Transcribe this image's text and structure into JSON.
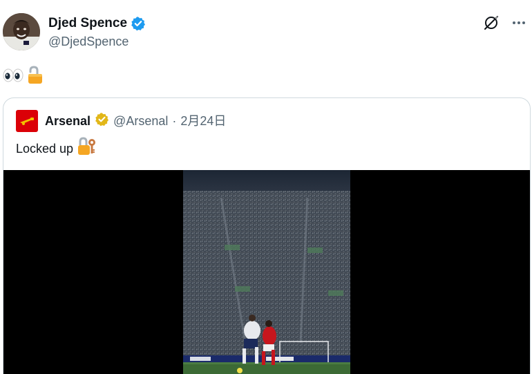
{
  "author": {
    "name": "Djed Spence",
    "handle": "@DjedSpence",
    "verified_color": "#1d9bf0"
  },
  "tweet": {
    "text_emoji": "👀🔓"
  },
  "actions": {
    "icons": [
      "grok-icon",
      "more-icon"
    ],
    "more_label": "···"
  },
  "quote": {
    "name": "Arsenal",
    "handle": "@Arsenal",
    "separator": "·",
    "date": "2月24日",
    "text": "Locked up",
    "text_emoji": "🔐",
    "badge_color": "#e2b719",
    "avatar_color": "#db0007"
  },
  "media": {
    "type": "video",
    "content": "football-match-stadium-frame"
  }
}
